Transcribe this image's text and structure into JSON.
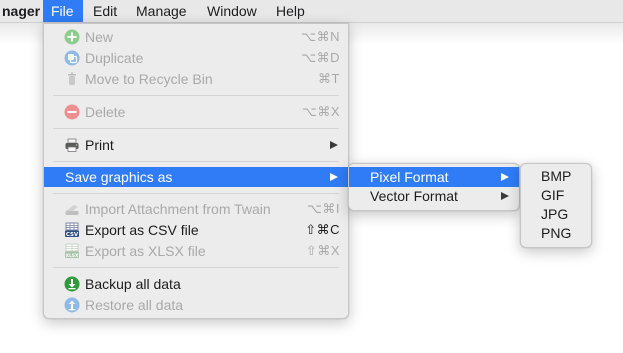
{
  "menubar": {
    "app_fragment": "nager",
    "items": [
      "File",
      "Edit",
      "Manage",
      "Window",
      "Help"
    ]
  },
  "file_menu": {
    "new": {
      "label": "New",
      "shortcut": "⌥⌘N",
      "icon": "plus-circle-icon"
    },
    "duplicate": {
      "label": "Duplicate",
      "shortcut": "⌥⌘D",
      "icon": "duplicate-icon"
    },
    "recycle": {
      "label": "Move to Recycle Bin",
      "shortcut": "⌘T",
      "icon": "trash-icon"
    },
    "delete": {
      "label": "Delete",
      "shortcut": "⌥⌘X",
      "icon": "minus-circle-icon"
    },
    "print": {
      "label": "Print",
      "icon": "printer-icon"
    },
    "save_graphics": {
      "label": "Save graphics as"
    },
    "import_twain": {
      "label": "Import Attachment from Twain",
      "shortcut": "⌥⌘I",
      "icon": "scanner-icon"
    },
    "export_csv": {
      "label": "Export as CSV file",
      "shortcut": "⇧⌘C",
      "icon": "csv-icon"
    },
    "export_xlsx": {
      "label": "Export as XLSX file",
      "shortcut": "⇧⌘X",
      "icon": "xlsx-icon"
    },
    "backup": {
      "label": "Backup all data",
      "icon": "download-icon"
    },
    "restore": {
      "label": "Restore all data",
      "icon": "upload-icon"
    }
  },
  "save_graphics_submenu": {
    "pixel": "Pixel Format",
    "vector": "Vector Format"
  },
  "pixel_submenu": {
    "items": [
      "BMP",
      "GIF",
      "JPG",
      "PNG"
    ]
  },
  "colors": {
    "accent": "#2f7cf6",
    "disabled_text": "#a9a9a9",
    "menu_bg": "#ececec"
  }
}
